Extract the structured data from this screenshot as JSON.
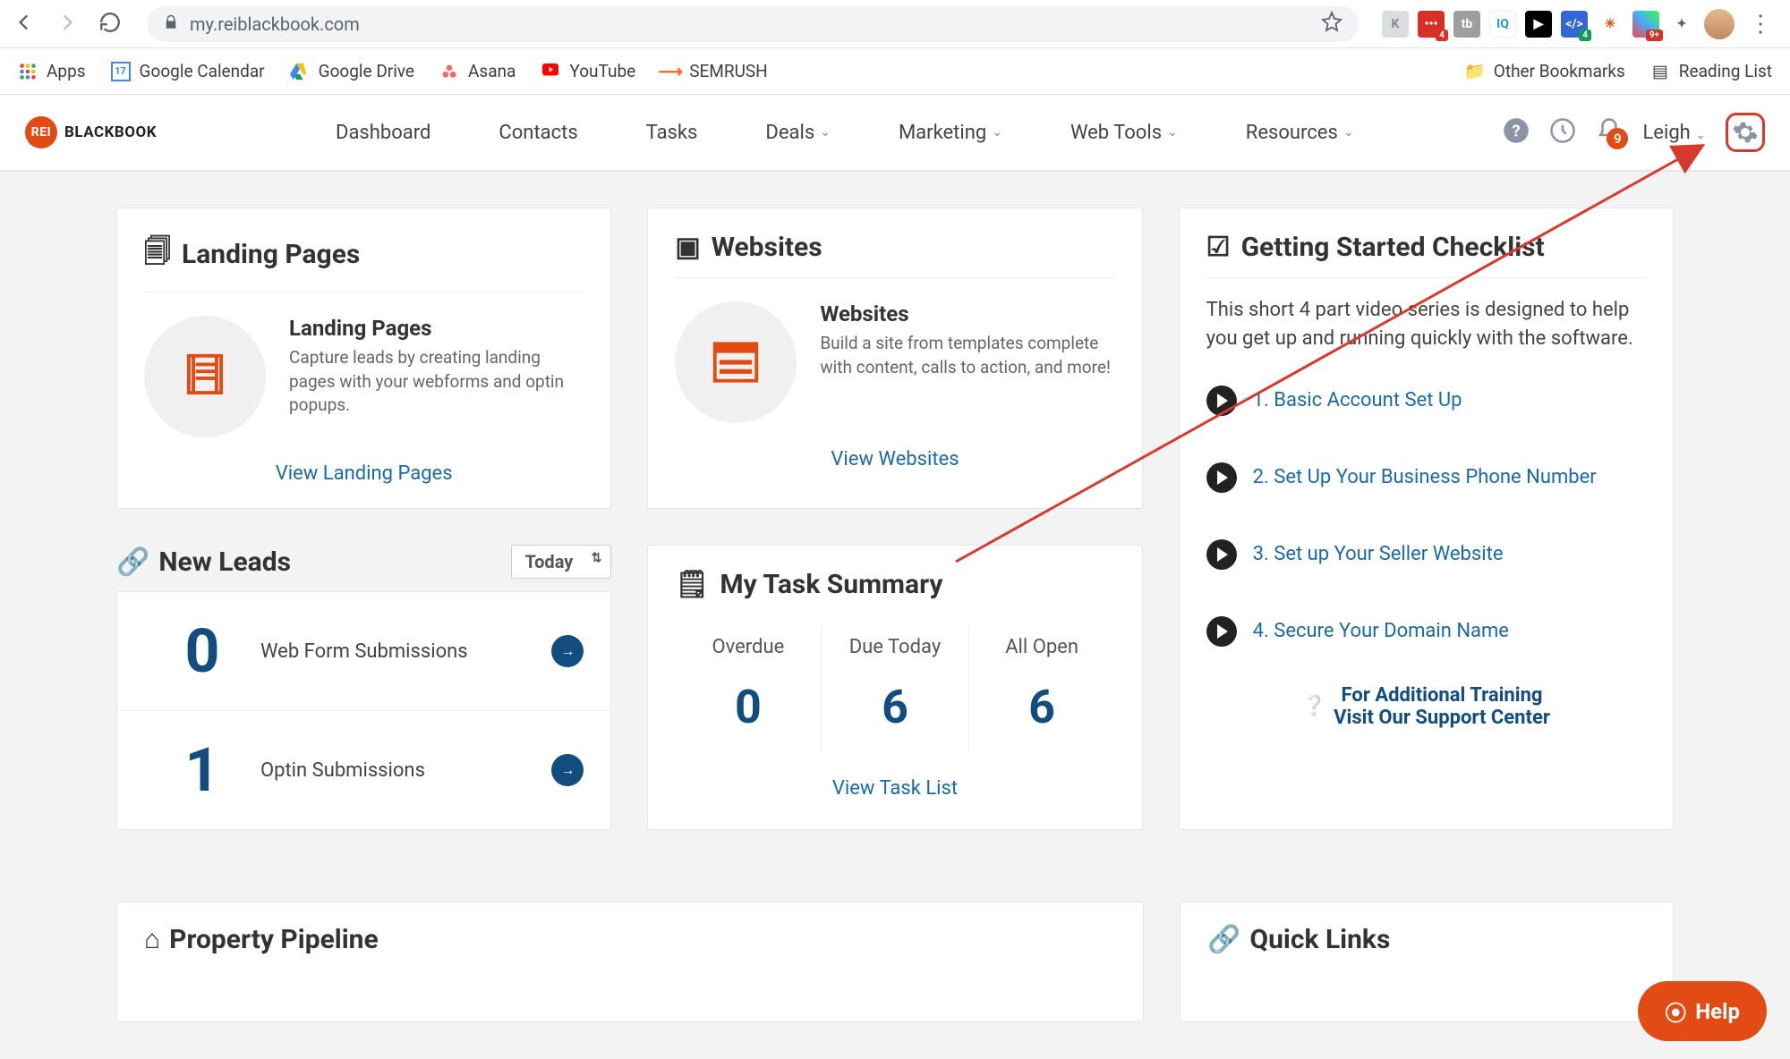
{
  "browser": {
    "url": "my.reiblackbook.com",
    "extensions_badges": {
      "red1": "4",
      "red2": "4",
      "red3": "9+"
    }
  },
  "bookmarks": {
    "apps": "Apps",
    "items": [
      "Google Calendar",
      "Google Drive",
      "Asana",
      "YouTube",
      "SEMRUSH"
    ],
    "other": "Other Bookmarks",
    "reading": "Reading List"
  },
  "nav": {
    "logo_text": "BLACKBOOK",
    "logo_badge": "REI",
    "items": [
      "Dashboard",
      "Contacts",
      "Tasks",
      "Deals",
      "Marketing",
      "Web Tools",
      "Resources"
    ],
    "dropdowns": [
      false,
      false,
      false,
      true,
      true,
      true,
      true
    ],
    "notification_count": "9",
    "username": "Leigh"
  },
  "cards": {
    "landing": {
      "title": "Landing Pages",
      "sub_title": "Landing Pages",
      "sub_desc": "Capture leads by creating landing pages with your webforms and optin popups.",
      "link": "View Landing Pages"
    },
    "websites": {
      "title": "Websites",
      "sub_title": "Websites",
      "sub_desc": "Build a site from templates complete with content, calls to action, and more!",
      "link": "View Websites"
    }
  },
  "leads": {
    "title": "New Leads",
    "filter": "Today",
    "rows": [
      {
        "count": "0",
        "label": "Web Form Submissions"
      },
      {
        "count": "1",
        "label": "Optin Submissions"
      }
    ]
  },
  "tasks": {
    "title": "My Task Summary",
    "cols": [
      {
        "label": "Overdue",
        "value": "0"
      },
      {
        "label": "Due Today",
        "value": "6"
      },
      {
        "label": "All Open",
        "value": "6"
      }
    ],
    "link": "View Task List"
  },
  "checklist": {
    "title": "Getting Started Checklist",
    "desc": "This short 4 part video series is designed to help you get up and running quickly with the software.",
    "items": [
      "1. Basic Account Set Up",
      "2. Set Up Your Business Phone Number",
      "3. Set up Your Seller Website",
      "4. Secure Your Domain Name"
    ],
    "training1": "For Additional Training",
    "training2": "Visit Our Support Center"
  },
  "bottom": {
    "pipeline": "Property Pipeline",
    "quick": "Quick Links"
  },
  "help_label": "Help"
}
